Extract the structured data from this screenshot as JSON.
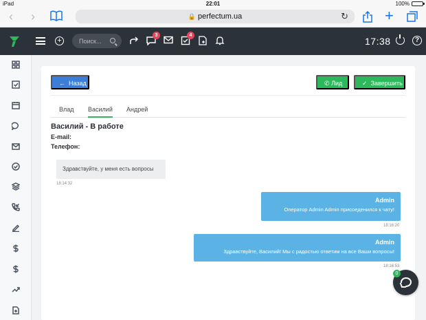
{
  "status_bar": {
    "device": "iPad",
    "time": "22:01",
    "battery": "100%"
  },
  "browser": {
    "url": "perfectum.ua"
  },
  "header": {
    "search_placeholder": "Поиск...",
    "chat_badge": "3",
    "tasks_badge": "4",
    "clock": "17:38",
    "help": "?"
  },
  "toolbar": {
    "back_label": "Назад",
    "lead_label": "Лид",
    "finish_label": "Завершить"
  },
  "tabs": [
    {
      "label": "Влад"
    },
    {
      "label": "Василий"
    },
    {
      "label": "Андрей"
    }
  ],
  "contact": {
    "title": "Василий - В работе",
    "email_label": "E-mail:",
    "phone_label": "Телефон:"
  },
  "messages": [
    {
      "text": "Здравствуйте, у меня есть вопросы",
      "time": "18:14:32"
    },
    {
      "author": "Admin",
      "text": "Оператор Admin Admin присоеденился к чату!",
      "time": "18:16:20"
    },
    {
      "author": "Admin",
      "text": "Здравствуйте, Василий! Мы с радостью ответим на все Ваши вопросы!",
      "time": "18:16:53"
    }
  ],
  "chat_widget": {
    "count": "0"
  },
  "colors": {
    "primary": "#3b7dd8",
    "success": "#2eb85c",
    "message_out": "#5ab3e4",
    "header": "#2c323a"
  }
}
